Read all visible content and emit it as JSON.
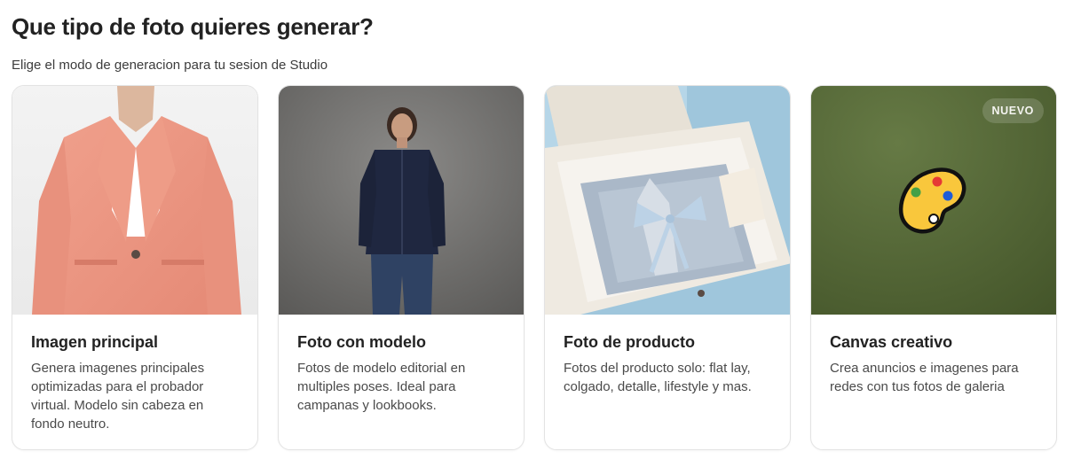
{
  "header": {
    "title": "Que tipo de foto quieres generar?",
    "subtitle": "Elige el modo de generacion para tu sesion de Studio"
  },
  "cards": [
    {
      "title": "Imagen principal",
      "description": "Genera imagenes principales optimizadas para el probador virtual. Modelo sin cabeza en fondo neutro.",
      "image": "coral-tweed-blazer-headless-model"
    },
    {
      "title": "Foto con modelo",
      "description": "Fotos de modelo editorial en multiples poses. Ideal para campanas y lookbooks.",
      "image": "model-navy-jacket-jeans"
    },
    {
      "title": "Foto de producto",
      "description": "Fotos del producto solo: flat lay, colgado, detalle, lifestyle y mas.",
      "image": "folded-blazer-in-gift-box"
    },
    {
      "title": "Canvas creativo",
      "description": "Crea anuncios e imagenes para redes con tus fotos de galeria",
      "badge": "NUEVO",
      "icon": "palette-icon",
      "colors": {
        "canvas_bg": "#4e6034"
      }
    }
  ]
}
